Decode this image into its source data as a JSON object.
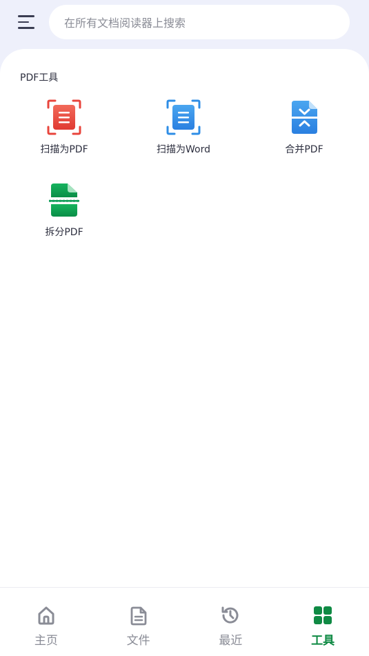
{
  "search": {
    "placeholder": "在所有文档阅读器上搜索"
  },
  "section": {
    "title": "PDF工具"
  },
  "tools": [
    {
      "label": "扫描为PDF",
      "icon": "scan-to-pdf-icon",
      "color": "#e8453c"
    },
    {
      "label": "扫描为Word",
      "icon": "scan-to-word-icon",
      "color": "#2e8de6"
    },
    {
      "label": "合并PDF",
      "icon": "merge-pdf-icon",
      "color": "#2e8de6"
    },
    {
      "label": "拆分PDF",
      "icon": "split-pdf-icon",
      "color": "#0f9d58"
    }
  ],
  "nav": [
    {
      "label": "主页",
      "icon": "home-icon",
      "active": false
    },
    {
      "label": "文件",
      "icon": "file-icon",
      "active": false
    },
    {
      "label": "最近",
      "icon": "history-icon",
      "active": false
    },
    {
      "label": "工具",
      "icon": "tools-grid-icon",
      "active": true
    }
  ],
  "colors": {
    "accent": "#0f8a44",
    "inactive": "#8a8c96",
    "background": "#eef0fb"
  }
}
